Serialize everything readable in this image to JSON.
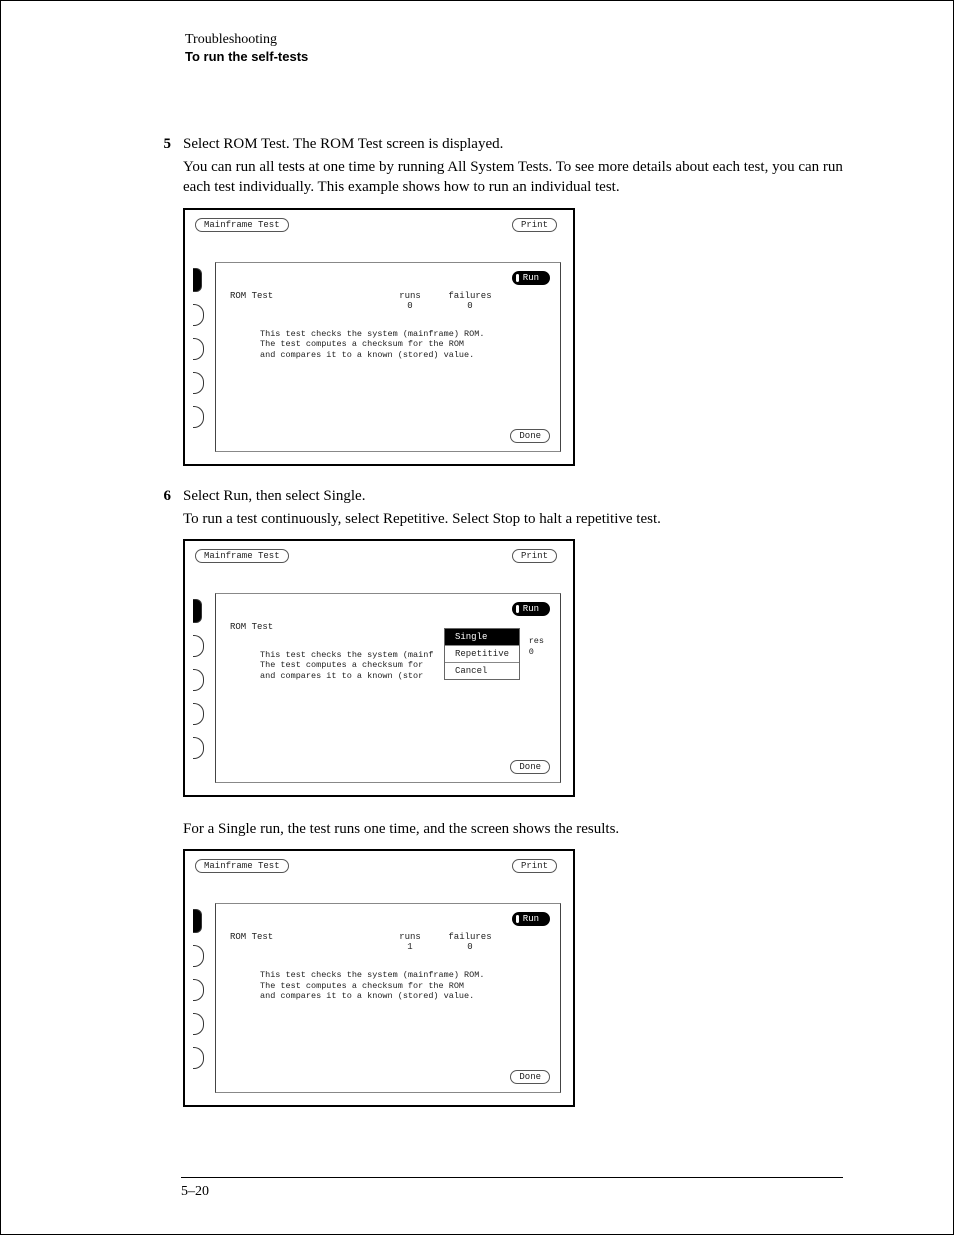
{
  "header": {
    "chapter": "Troubleshooting",
    "section": "To run the self-tests"
  },
  "step5": {
    "num": "5",
    "title": "Select ROM Test.  The ROM Test screen is displayed.",
    "body": "You can run all tests at one time by running All System Tests.  To see more details about  each test, you can run each test individually.  This example shows how to run an individual test."
  },
  "step6": {
    "num": "6",
    "title": "Select Run, then select Single.",
    "body": "To run a test continuously, select Repetitive.  Select Stop to halt a repetitive test."
  },
  "caption3": "For a Single run, the test runs one time, and the screen shows the results.",
  "screen1": {
    "menu": "Mainframe Test",
    "print": "Print",
    "run": "Run",
    "test_name": "ROM Test",
    "runs_label": "runs",
    "runs_val": "0",
    "fail_label": "failures",
    "fail_val": "0",
    "desc1": "This test checks the system (mainframe) ROM.",
    "desc2": "The test computes a checksum for the ROM",
    "desc3": "and compares it to a known (stored) value.",
    "done": "Done"
  },
  "screen2": {
    "menu": "Mainframe Test",
    "print": "Print",
    "run": "Run",
    "test_name": "ROM Test",
    "desc1": "This test checks the system (mainf",
    "desc2": "The test computes a checksum for",
    "desc3": "and compares it to a known (stor",
    "popup_single": "Single",
    "popup_repetitive": "Repetitive",
    "popup_cancel": "Cancel",
    "frag1": "res",
    "frag2": "0",
    "done": "Done"
  },
  "screen3": {
    "menu": "Mainframe Test",
    "print": "Print",
    "run": "Run",
    "test_name": "ROM Test",
    "runs_label": "runs",
    "runs_val": "1",
    "fail_label": "failures",
    "fail_val": "0",
    "desc1": "This test checks the system (mainframe) ROM.",
    "desc2": "The test computes a checksum for the ROM",
    "desc3": "and compares it to a known (stored) value.",
    "done": "Done"
  },
  "page_number": "5–20"
}
